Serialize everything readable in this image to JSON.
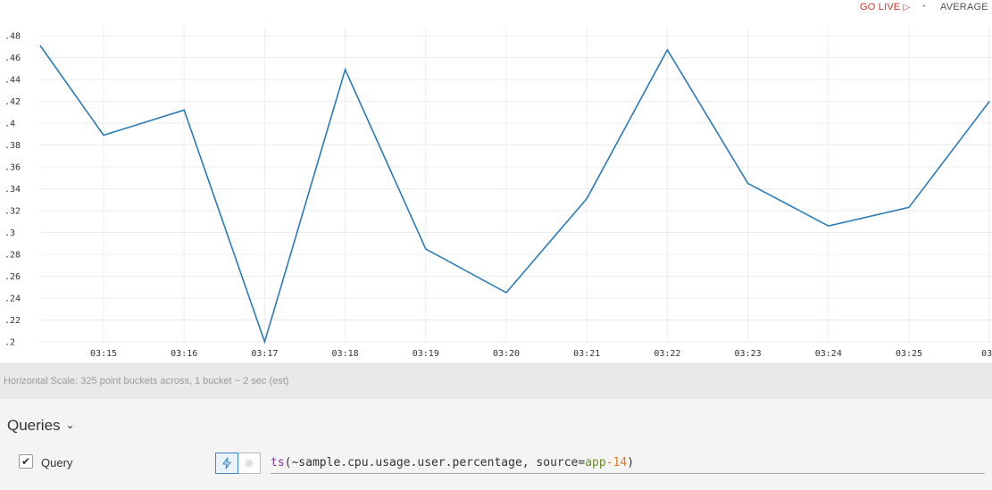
{
  "header": {
    "go_live_label": "GO LIVE",
    "play_glyph": "▷",
    "separator": "•",
    "average_label": "AVERAGE"
  },
  "chart_data": {
    "type": "line",
    "title": "",
    "xlabel": "",
    "ylabel": "",
    "yticks": [
      ".48",
      ".46",
      ".44",
      ".42",
      ".4",
      ".38",
      ".36",
      ".34",
      ".32",
      ".3",
      ".28",
      ".26",
      ".24",
      ".22",
      ".2"
    ],
    "ylim": [
      0.2,
      0.48
    ],
    "xticks": [
      "03:15",
      "03:16",
      "03:17",
      "03:18",
      "03:19",
      "03:20",
      "03:21",
      "03:22",
      "03:23",
      "03:24",
      "03:25",
      "03:"
    ],
    "x": [
      "03:14:40",
      "03:15",
      "03:16",
      "03:17",
      "03:18",
      "03:19",
      "03:20",
      "03:21",
      "03:22",
      "03:23",
      "03:24",
      "03:25",
      "03:26"
    ],
    "series": [
      {
        "values": [
          0.471,
          0.389,
          0.412,
          0.2,
          0.449,
          0.285,
          0.245,
          0.331,
          0.467,
          0.345,
          0.306,
          0.323,
          0.42
        ],
        "color": "#2a7ab5"
      }
    ],
    "grid": true
  },
  "scale_info": "Horizontal Scale: 325 point buckets across, 1 bucket ~ 2 sec (est)",
  "queries": {
    "header_label": "Queries",
    "chevron_glyph": "⌄",
    "items": [
      {
        "checked": true,
        "checkmark": "✔",
        "label": "Query",
        "func": "ts",
        "open": "(",
        "metric": "~sample.cpu.usage.user.percentage",
        "comma": ", ",
        "source_key": "source",
        "equals": "=",
        "source_val": "app",
        "dash": "-",
        "source_num": "14",
        "close": ")"
      }
    ]
  },
  "colors": {
    "accent": "#3a86c8",
    "go_live": "#c0392b",
    "series": "#2a7ab5"
  }
}
